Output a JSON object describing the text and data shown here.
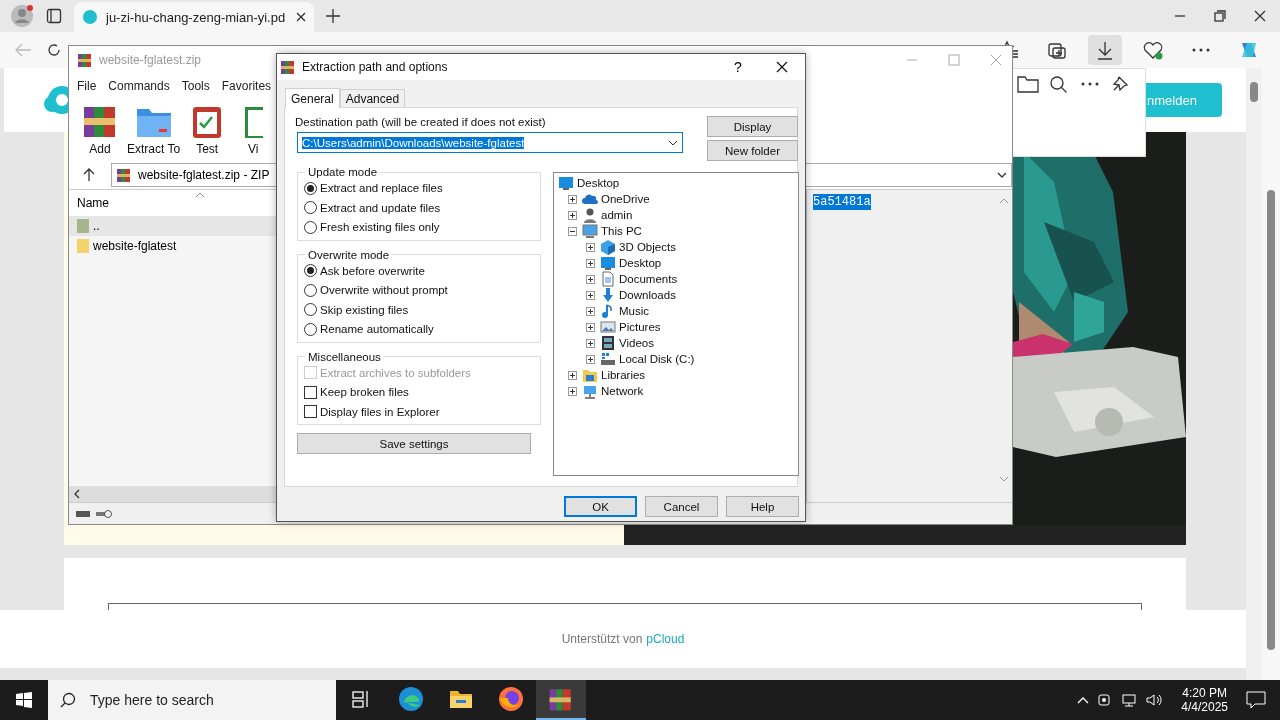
{
  "browser": {
    "tabs": [
      {
        "title": "ju-zi-hu-chang-zeng-mian-yi.pd",
        "selected": true
      }
    ],
    "page": {
      "login_button": "nmelden",
      "footer_text": "Unterstützt von",
      "footer_link": "pCloud"
    }
  },
  "winrar": {
    "title": "website-fglatest.zip",
    "menu": [
      "File",
      "Commands",
      "Tools",
      "Favorites"
    ],
    "tools": [
      {
        "label": "Add",
        "kind": "add"
      },
      {
        "label": "Extract To",
        "kind": "extract"
      },
      {
        "label": "Test",
        "kind": "test"
      },
      {
        "label": "Vi",
        "kind": "view"
      }
    ],
    "address": "website-fglatest.zip - ZIP",
    "column": "Name",
    "files": [
      {
        "name": "..",
        "kind": "parent",
        "selected": true
      },
      {
        "name": "website-fglatest",
        "kind": "folder",
        "selected": false
      }
    ],
    "comment": "5a51481a"
  },
  "dialog": {
    "title": "Extraction path and options",
    "help": "?",
    "tabs": [
      {
        "label": "General",
        "selected": true
      },
      {
        "label": "Advanced",
        "selected": false
      }
    ],
    "destination_label": "Destination path (will be created if does not exist)",
    "destination_path": "C:\\Users\\admin\\Downloads\\website-fglatest",
    "side_buttons": [
      "Display",
      "New folder"
    ],
    "groups": [
      {
        "title": "Update mode",
        "kind": "radio",
        "options": [
          {
            "label": "Extract and replace files",
            "selected": true
          },
          {
            "label": "Extract and update files",
            "selected": false
          },
          {
            "label": "Fresh existing files only",
            "selected": false
          }
        ]
      },
      {
        "title": "Overwrite mode",
        "kind": "radio",
        "options": [
          {
            "label": "Ask before overwrite",
            "selected": true
          },
          {
            "label": "Overwrite without prompt",
            "selected": false
          },
          {
            "label": "Skip existing files",
            "selected": false
          },
          {
            "label": "Rename automatically",
            "selected": false
          }
        ]
      },
      {
        "title": "Miscellaneous",
        "kind": "checkbox",
        "options": [
          {
            "label": "Extract archives to subfolders",
            "checked": false,
            "disabled": true
          },
          {
            "label": "Keep broken files",
            "checked": false,
            "disabled": false
          },
          {
            "label": "Display files in Explorer",
            "checked": false,
            "disabled": false
          }
        ]
      }
    ],
    "save_button": "Save settings",
    "tree": [
      {
        "label": "Desktop",
        "kind": "desktop",
        "children": [
          {
            "label": "OneDrive",
            "kind": "cloud",
            "expanded": false
          },
          {
            "label": "admin",
            "kind": "user",
            "expanded": false
          },
          {
            "label": "This PC",
            "kind": "computer",
            "expanded": true,
            "children": [
              {
                "label": "3D Objects",
                "kind": "cube",
                "expanded": false
              },
              {
                "label": "Desktop",
                "kind": "desktop",
                "expanded": false
              },
              {
                "label": "Documents",
                "kind": "document",
                "expanded": false
              },
              {
                "label": "Downloads",
                "kind": "download",
                "expanded": false
              },
              {
                "label": "Music",
                "kind": "music",
                "expanded": false
              },
              {
                "label": "Pictures",
                "kind": "picture",
                "expanded": false
              },
              {
                "label": "Videos",
                "kind": "video",
                "expanded": false
              },
              {
                "label": "Local Disk (C:)",
                "kind": "disk",
                "expanded": false
              }
            ]
          },
          {
            "label": "Libraries",
            "kind": "library",
            "expanded": false
          },
          {
            "label": "Network",
            "kind": "network",
            "expanded": false
          }
        ]
      }
    ],
    "buttons": [
      {
        "label": "OK",
        "default": true
      },
      {
        "label": "Cancel",
        "default": false
      },
      {
        "label": "Help",
        "default": false
      }
    ]
  },
  "taskbar": {
    "search_placeholder": "Type here to search",
    "time": "4:20 PM",
    "date": "4/4/2025",
    "apps": [
      {
        "kind": "taskview",
        "active": false
      },
      {
        "kind": "edge",
        "active": false
      },
      {
        "kind": "explorer",
        "active": false
      },
      {
        "kind": "firefox",
        "active": false
      },
      {
        "kind": "winrar",
        "active": true
      }
    ]
  }
}
